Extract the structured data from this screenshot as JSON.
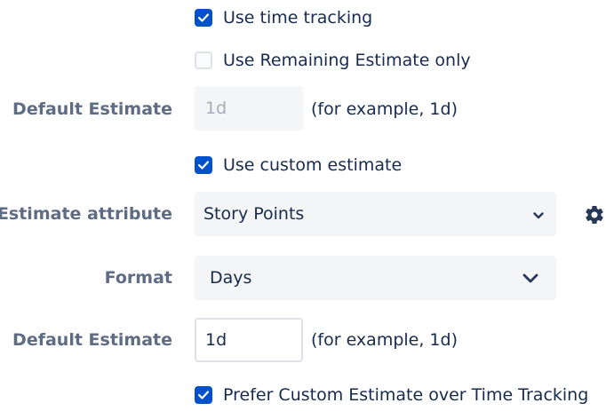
{
  "time_tracking": {
    "use_time_tracking": {
      "label": "Use time tracking",
      "checked": true
    },
    "use_remaining_estimate_only": {
      "label": "Use Remaining Estimate only",
      "checked": false
    },
    "default_estimate": {
      "label": "Default Estimate",
      "placeholder": "1d",
      "hint": "(for example, 1d)",
      "disabled": true
    }
  },
  "custom_estimate": {
    "use_custom_estimate": {
      "label": "Use custom estimate",
      "checked": true
    },
    "estimate_attribute": {
      "label": "Estimate attribute",
      "selected": "Story Points",
      "settings_icon": "gear-icon"
    },
    "format": {
      "label": "Format",
      "selected": "Days"
    },
    "default_estimate": {
      "label": "Default Estimate",
      "value": "1d",
      "hint": "(for example, 1d)"
    },
    "prefer_custom": {
      "label": "Prefer Custom Estimate over Time Tracking",
      "checked": true
    }
  },
  "colors": {
    "checkbox_checked": "#0052cc",
    "label_text": "#5e6c84",
    "body_text": "#172b4d",
    "field_background": "#f4f5f7"
  }
}
